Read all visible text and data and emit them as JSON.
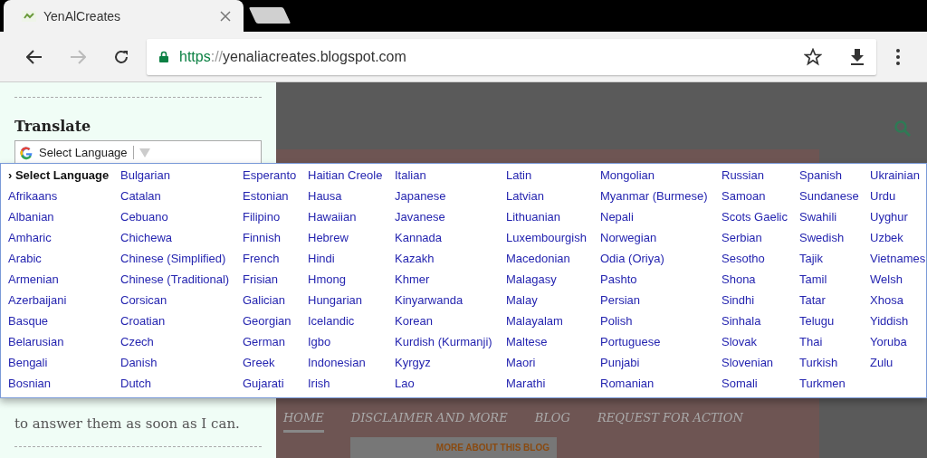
{
  "browser": {
    "tab_title": "YenAlCreates",
    "url_scheme": "https",
    "url_separator": "://",
    "url_host": "yenaliacreates.blogspot.com"
  },
  "sidebar": {
    "widget_title": "Translate",
    "select_value": "Select Language",
    "text_line": "to answer them as soon as I can."
  },
  "page": {
    "nav": [
      {
        "label": "HOME",
        "selected": true
      },
      {
        "label": "DISCLAIMER AND MORE",
        "selected": false
      },
      {
        "label": "BLOG",
        "selected": false
      },
      {
        "label": "REQUEST FOR ACTION",
        "selected": false
      }
    ],
    "about_link": "MORE ABOUT THIS BLOG"
  },
  "language_menu": {
    "columns": [
      [
        {
          "label": "› Select Language",
          "selected": true
        },
        {
          "label": "Afrikaans",
          "selected": false
        },
        {
          "label": "Albanian",
          "selected": false
        },
        {
          "label": "Amharic",
          "selected": false
        },
        {
          "label": "Arabic",
          "selected": false
        },
        {
          "label": "Armenian",
          "selected": false
        },
        {
          "label": "Azerbaijani",
          "selected": false
        },
        {
          "label": "Basque",
          "selected": false
        },
        {
          "label": "Belarusian",
          "selected": false
        },
        {
          "label": "Bengali",
          "selected": false
        },
        {
          "label": "Bosnian",
          "selected": false
        }
      ],
      [
        {
          "label": "Bulgarian",
          "selected": false
        },
        {
          "label": "Catalan",
          "selected": false
        },
        {
          "label": "Cebuano",
          "selected": false
        },
        {
          "label": "Chichewa",
          "selected": false
        },
        {
          "label": "Chinese (Simplified)",
          "selected": false
        },
        {
          "label": "Chinese (Traditional)",
          "selected": false
        },
        {
          "label": "Corsican",
          "selected": false
        },
        {
          "label": "Croatian",
          "selected": false
        },
        {
          "label": "Czech",
          "selected": false
        },
        {
          "label": "Danish",
          "selected": false
        },
        {
          "label": "Dutch",
          "selected": false
        }
      ],
      [
        {
          "label": "Esperanto",
          "selected": false
        },
        {
          "label": "Estonian",
          "selected": false
        },
        {
          "label": "Filipino",
          "selected": false
        },
        {
          "label": "Finnish",
          "selected": false
        },
        {
          "label": "French",
          "selected": false
        },
        {
          "label": "Frisian",
          "selected": false
        },
        {
          "label": "Galician",
          "selected": false
        },
        {
          "label": "Georgian",
          "selected": false
        },
        {
          "label": "German",
          "selected": false
        },
        {
          "label": "Greek",
          "selected": false
        },
        {
          "label": "Gujarati",
          "selected": false
        }
      ],
      [
        {
          "label": "Haitian Creole",
          "selected": false
        },
        {
          "label": "Hausa",
          "selected": false
        },
        {
          "label": "Hawaiian",
          "selected": false
        },
        {
          "label": "Hebrew",
          "selected": false
        },
        {
          "label": "Hindi",
          "selected": false
        },
        {
          "label": "Hmong",
          "selected": false
        },
        {
          "label": "Hungarian",
          "selected": false
        },
        {
          "label": "Icelandic",
          "selected": false
        },
        {
          "label": "Igbo",
          "selected": false
        },
        {
          "label": "Indonesian",
          "selected": false
        },
        {
          "label": "Irish",
          "selected": false
        }
      ],
      [
        {
          "label": "Italian",
          "selected": false
        },
        {
          "label": "Japanese",
          "selected": false
        },
        {
          "label": "Javanese",
          "selected": false
        },
        {
          "label": "Kannada",
          "selected": false
        },
        {
          "label": "Kazakh",
          "selected": false
        },
        {
          "label": "Khmer",
          "selected": false
        },
        {
          "label": "Kinyarwanda",
          "selected": false
        },
        {
          "label": "Korean",
          "selected": false
        },
        {
          "label": "Kurdish (Kurmanji)",
          "selected": false
        },
        {
          "label": "Kyrgyz",
          "selected": false
        },
        {
          "label": "Lao",
          "selected": false
        }
      ],
      [
        {
          "label": "Latin",
          "selected": false
        },
        {
          "label": "Latvian",
          "selected": false
        },
        {
          "label": "Lithuanian",
          "selected": false
        },
        {
          "label": "Luxembourgish",
          "selected": false
        },
        {
          "label": "Macedonian",
          "selected": false
        },
        {
          "label": "Malagasy",
          "selected": false
        },
        {
          "label": "Malay",
          "selected": false
        },
        {
          "label": "Malayalam",
          "selected": false
        },
        {
          "label": "Maltese",
          "selected": false
        },
        {
          "label": "Maori",
          "selected": false
        },
        {
          "label": "Marathi",
          "selected": false
        }
      ],
      [
        {
          "label": "Mongolian",
          "selected": false
        },
        {
          "label": "Myanmar (Burmese)",
          "selected": false
        },
        {
          "label": "Nepali",
          "selected": false
        },
        {
          "label": "Norwegian",
          "selected": false
        },
        {
          "label": "Odia (Oriya)",
          "selected": false
        },
        {
          "label": "Pashto",
          "selected": false
        },
        {
          "label": "Persian",
          "selected": false
        },
        {
          "label": "Polish",
          "selected": false
        },
        {
          "label": "Portuguese",
          "selected": false
        },
        {
          "label": "Punjabi",
          "selected": false
        },
        {
          "label": "Romanian",
          "selected": false
        }
      ],
      [
        {
          "label": "Russian",
          "selected": false
        },
        {
          "label": "Samoan",
          "selected": false
        },
        {
          "label": "Scots Gaelic",
          "selected": false
        },
        {
          "label": "Serbian",
          "selected": false
        },
        {
          "label": "Sesotho",
          "selected": false
        },
        {
          "label": "Shona",
          "selected": false
        },
        {
          "label": "Sindhi",
          "selected": false
        },
        {
          "label": "Sinhala",
          "selected": false
        },
        {
          "label": "Slovak",
          "selected": false
        },
        {
          "label": "Slovenian",
          "selected": false
        },
        {
          "label": "Somali",
          "selected": false
        }
      ],
      [
        {
          "label": "Spanish",
          "selected": false
        },
        {
          "label": "Sundanese",
          "selected": false
        },
        {
          "label": "Swahili",
          "selected": false
        },
        {
          "label": "Swedish",
          "selected": false
        },
        {
          "label": "Tajik",
          "selected": false
        },
        {
          "label": "Tamil",
          "selected": false
        },
        {
          "label": "Tatar",
          "selected": false
        },
        {
          "label": "Telugu",
          "selected": false
        },
        {
          "label": "Thai",
          "selected": false
        },
        {
          "label": "Turkish",
          "selected": false
        },
        {
          "label": "Turkmen",
          "selected": false
        }
      ],
      [
        {
          "label": "Ukrainian",
          "selected": false
        },
        {
          "label": "Urdu",
          "selected": false
        },
        {
          "label": "Uyghur",
          "selected": false
        },
        {
          "label": "Uzbek",
          "selected": false
        },
        {
          "label": "Vietnames",
          "selected": false
        },
        {
          "label": "Welsh",
          "selected": false
        },
        {
          "label": "Xhosa",
          "selected": false
        },
        {
          "label": "Yiddish",
          "selected": false
        },
        {
          "label": "Yoruba",
          "selected": false
        },
        {
          "label": "Zulu",
          "selected": false
        }
      ]
    ]
  }
}
